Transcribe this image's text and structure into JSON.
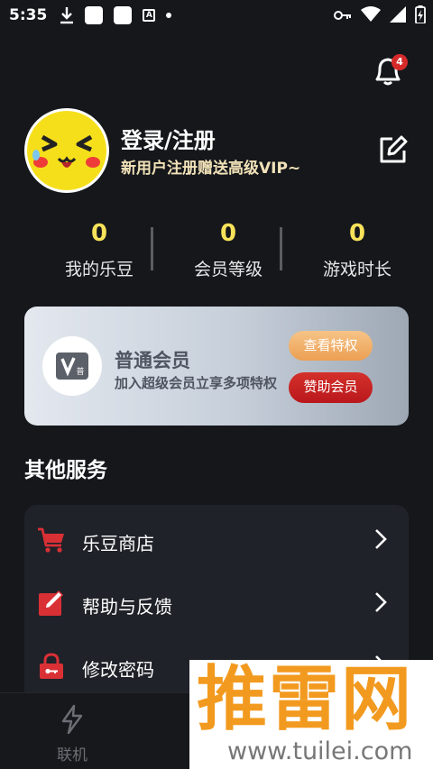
{
  "status_bar": {
    "time": "5:35",
    "icons_left": [
      "download-icon",
      "app-square-icon",
      "app-square-icon",
      "font-a-icon",
      "dot-icon"
    ],
    "icons_right": [
      "key-icon",
      "wifi-icon",
      "signal-icon",
      "battery-icon"
    ]
  },
  "header": {
    "notification_count": "4"
  },
  "profile": {
    "title": "登录/注册",
    "subtitle": "新用户注册赠送高级VIP~"
  },
  "stats": [
    {
      "value": "0",
      "label": "我的乐豆"
    },
    {
      "value": "0",
      "label": "会员等级"
    },
    {
      "value": "0",
      "label": "游戏时长"
    }
  ],
  "member_card": {
    "logo_text": "普",
    "title": "普通会员",
    "description": "加入超级会员立享多项特权",
    "privilege_button": "查看特权",
    "sponsor_button": "赞助会员"
  },
  "services": {
    "title": "其他服务",
    "items": [
      {
        "label": "乐豆商店",
        "icon": "cart-icon"
      },
      {
        "label": "帮助与反馈",
        "icon": "feedback-edit-icon"
      },
      {
        "label": "修改密码",
        "icon": "lock-icon"
      }
    ]
  },
  "bottom_nav": {
    "items": [
      {
        "label": "联机",
        "icon": "lightning-icon"
      }
    ]
  },
  "watermark": {
    "title": "推雷网",
    "url": "www.tuilei.com"
  },
  "colors": {
    "background": "#15171b",
    "stat_value": "#f8e25a",
    "subtitle": "#f1e2b8",
    "badge": "#d62a2a",
    "privilege_button": "#ec9f53",
    "sponsor_button": "#b9171b",
    "watermark": "#f29a1f"
  }
}
